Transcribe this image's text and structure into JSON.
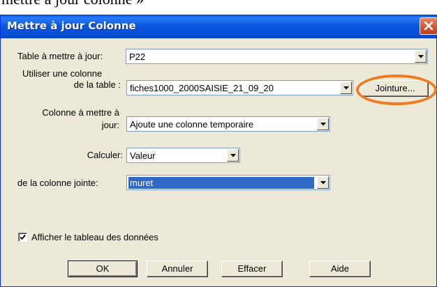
{
  "caption": "mettre à jour colonne »",
  "window": {
    "title": "Mettre à jour Colonne"
  },
  "form": {
    "table_label": "Table à mettre à jour:",
    "table_value": "P22",
    "source_label_line1": "Utiliser une colonne",
    "source_label_line2": "de la table :",
    "source_value": "fiches1000_2000SAISIE_21_09_20",
    "join_button": "Jointure...",
    "column_label_line1": "Colonne à mettre à",
    "column_label_line2": "jour:",
    "column_value": "Ajoute une colonne temporaire",
    "compute_label": "Calculer:",
    "compute_value": "Valeur",
    "joined_label": "de la colonne jointe:",
    "joined_value": "muret"
  },
  "options": {
    "show_table_label": "Afficher le tableau des données",
    "show_table_checked": true
  },
  "buttons": {
    "ok": "OK",
    "cancel": "Annuler",
    "clear": "Effacer",
    "help": "Aide"
  },
  "colors": {
    "titlebar": "#0a58df",
    "dialog_bg": "#ece9d8",
    "selection": "#316ac5",
    "highlight_ring": "#f07a1e",
    "close_button": "#d2532d"
  }
}
